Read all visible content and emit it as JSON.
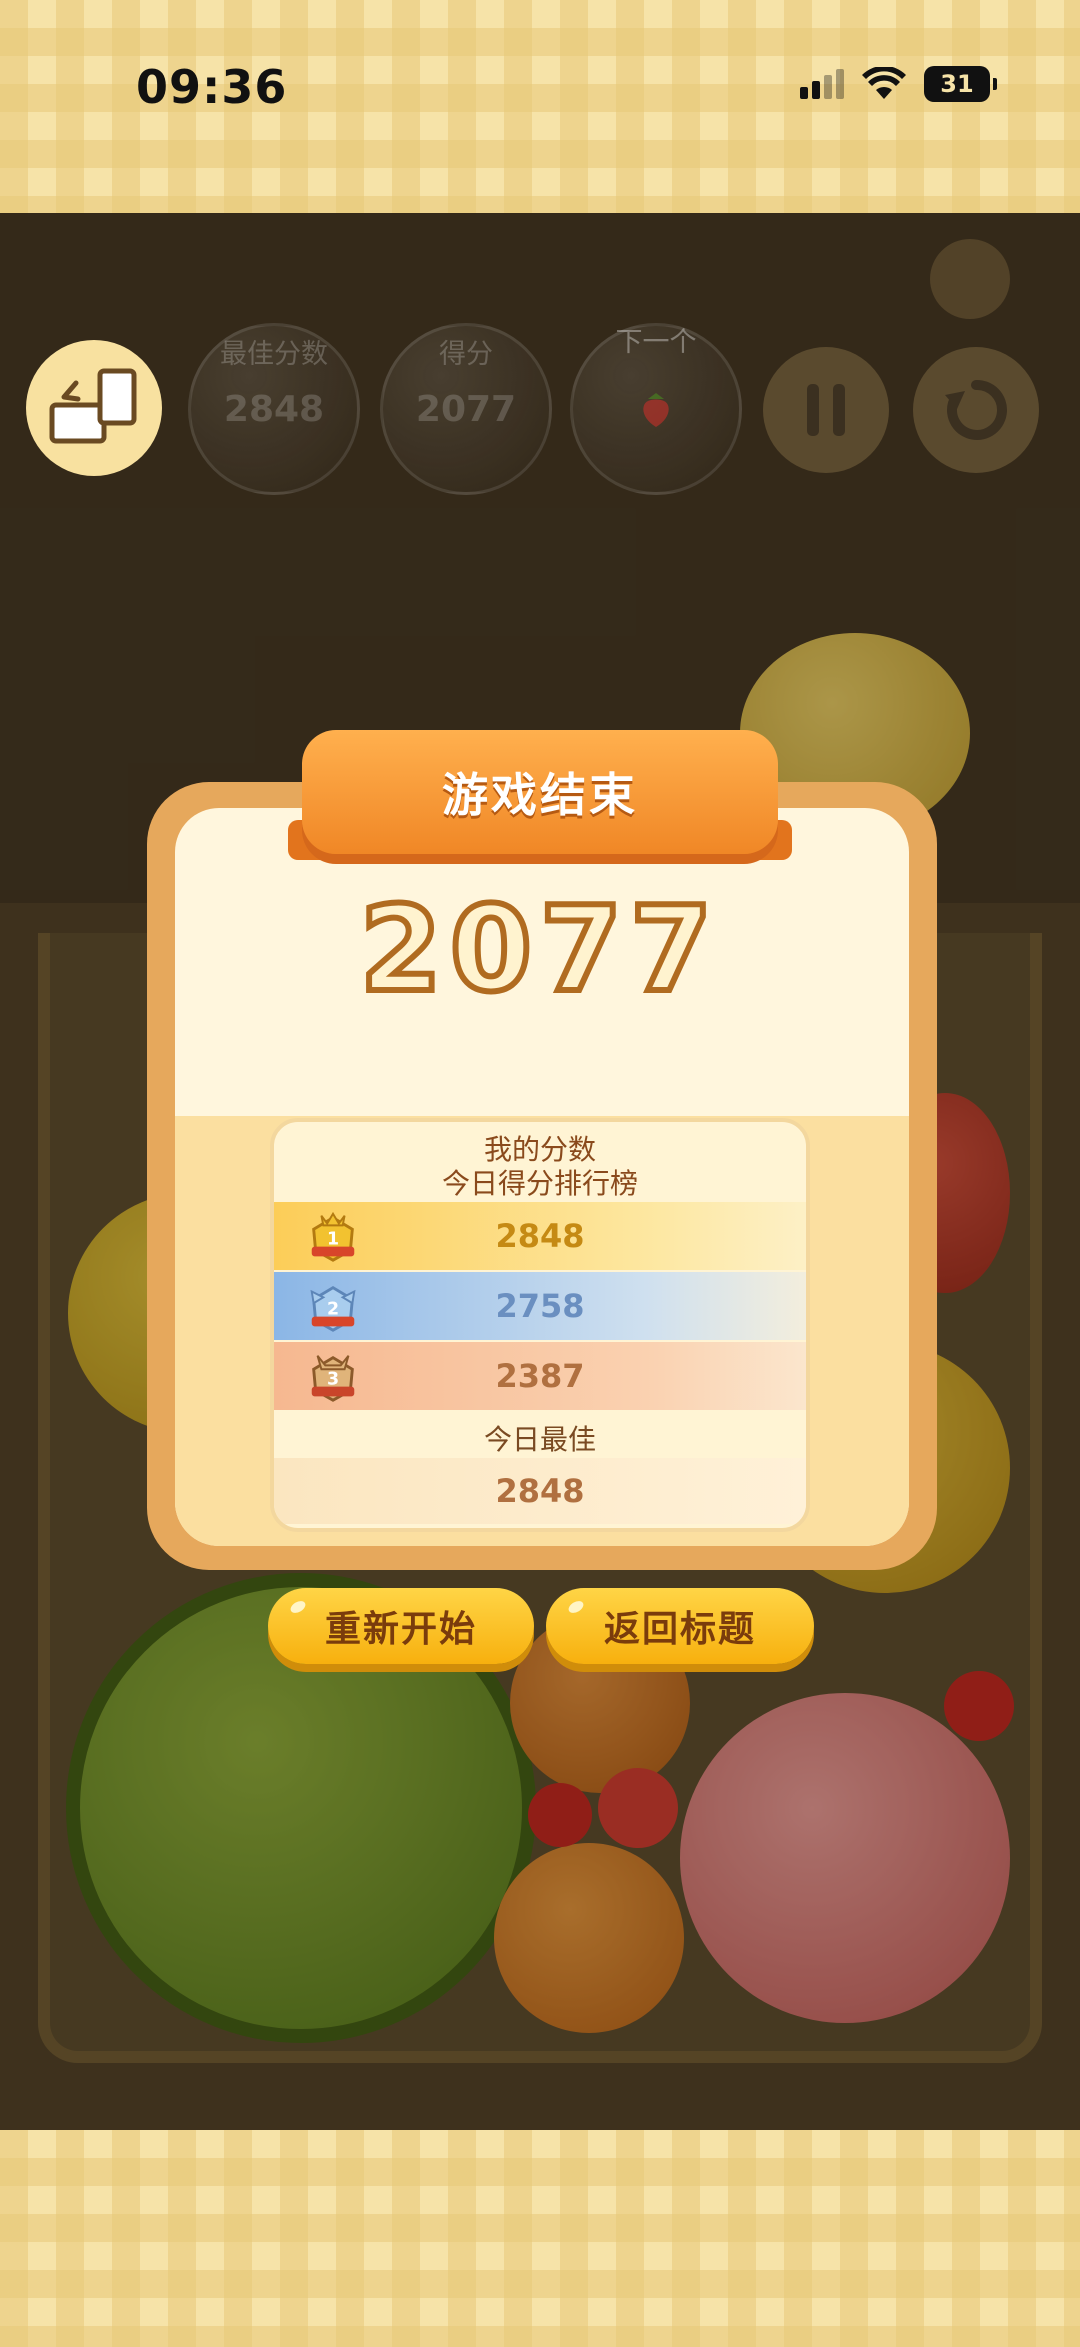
{
  "status_bar": {
    "time": "09:36",
    "battery": "31"
  },
  "hud": {
    "best_label": "最佳分数",
    "best_value": "2848",
    "score_label": "得分",
    "score_value": "2077",
    "next_label": "下一个",
    "next_fruit_icon": "strawberry-icon",
    "rotate_icon": "rotate-screen-icon",
    "pause_icon": "pause-icon",
    "restart_icon": "restart-icon"
  },
  "dialog": {
    "title": "游戏结束",
    "final_score": "2077",
    "my_score_label": "我的分数",
    "leaderboard_title": "今日得分排行榜",
    "ranks": [
      {
        "rank": "1",
        "score": "2848"
      },
      {
        "rank": "2",
        "score": "2758"
      },
      {
        "rank": "3",
        "score": "2387"
      }
    ],
    "today_best_label": "今日最佳",
    "today_best_value": "2848"
  },
  "buttons": {
    "restart": "重新开始",
    "back_to_title": "返回标题"
  },
  "colors": {
    "accent_orange": "#f08726",
    "button_yellow": "#f7b00e",
    "gold": "#c58a14",
    "silver_blue": "#6a8fc0",
    "bronze": "#b07040"
  }
}
